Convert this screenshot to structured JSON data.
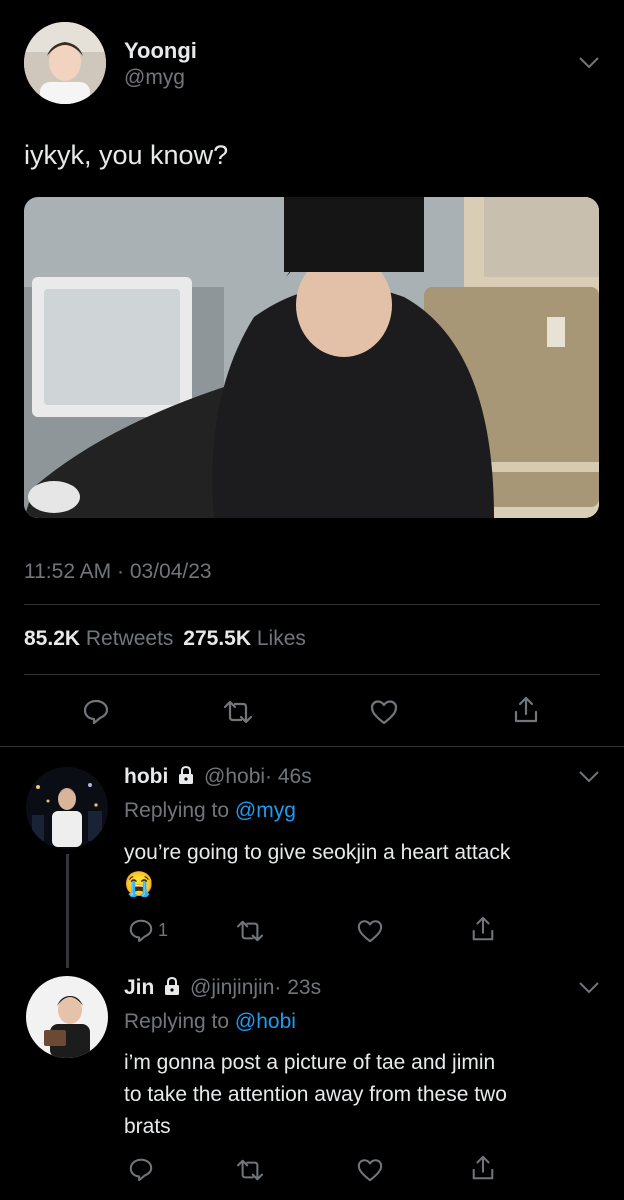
{
  "main_tweet": {
    "author_name": "Yoongi",
    "author_handle": "@myg",
    "text": "iykyk, you know?",
    "timestamp": "11:52 AM · 03/04/23",
    "retweets_count": "85.2K",
    "retweets_label": "Retweets",
    "likes_count": "275.5K",
    "likes_label": "Likes"
  },
  "replies": [
    {
      "author_name": "hobi",
      "author_handle": "@hobi",
      "age": "· 46s",
      "replying_label": "Replying to",
      "replying_handle": "@myg",
      "text": "you’re going to give seokjin a heart attack",
      "emoji": "😭",
      "reply_count": "1"
    },
    {
      "author_name": "Jin",
      "author_handle": "@jinjinjin",
      "age": "· 23s",
      "replying_label": "Replying to",
      "replying_handle": "@hobi",
      "text_lines": [
        "i’m gonna post a picture of tae and jimin",
        "to take the attention away from these two",
        "brats"
      ]
    }
  ],
  "colors": {
    "background": "#000000",
    "text": "#e7e9ea",
    "muted": "#71767b",
    "link": "#1d9bf0",
    "divider": "#2f3336"
  }
}
